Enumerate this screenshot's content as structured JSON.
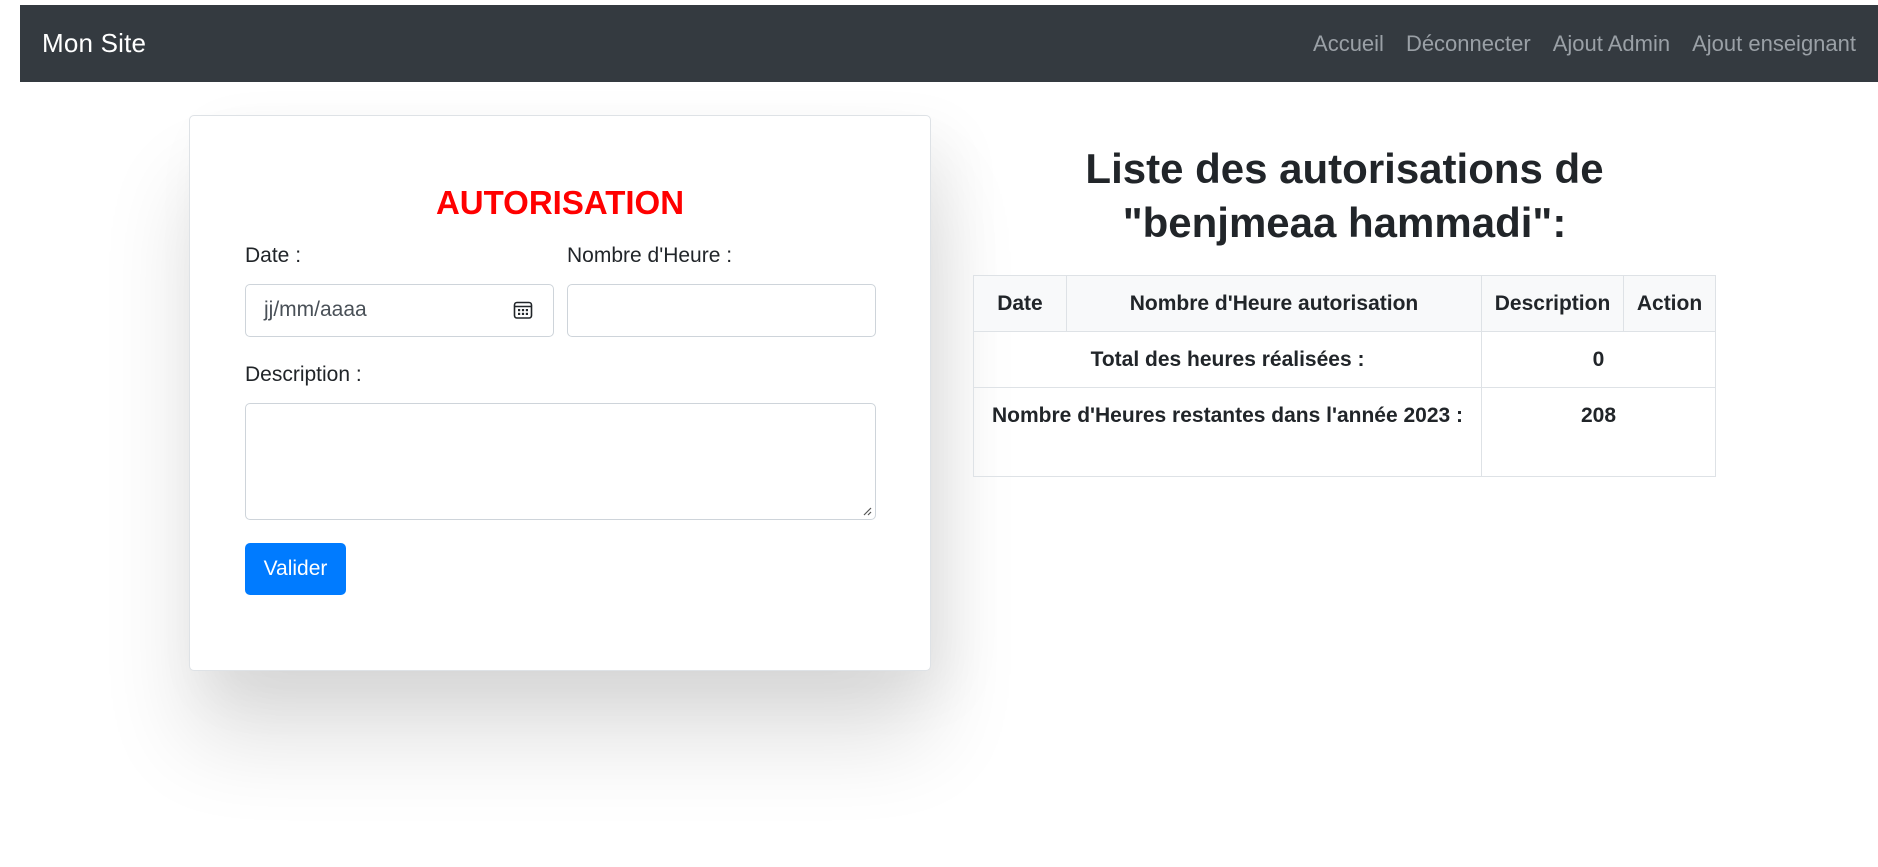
{
  "navbar": {
    "brand": "Mon Site",
    "links": [
      "Accueil",
      "Déconnecter",
      "Ajout Admin",
      "Ajout enseignant"
    ]
  },
  "form": {
    "title": "AUTORISATION",
    "date_label": "Date :",
    "date_placeholder": "jj/mm/aaaa",
    "hours_label": "Nombre d'Heure :",
    "hours_value": "",
    "description_label": "Description :",
    "description_value": "",
    "submit_label": "Valider"
  },
  "list": {
    "title": "Liste des autorisations de \"benjmeaa hammadi\":",
    "headers": [
      "Date",
      "Nombre d'Heure autorisation",
      "Description",
      "Action"
    ],
    "total_label": "Total des heures réalisées :",
    "total_value": "0",
    "remaining_label": "Nombre d'Heures restantes dans l'année 2023 :",
    "remaining_value": "208"
  },
  "colors": {
    "navbar_bg": "#343a40",
    "title_red": "#ff0000",
    "button_blue": "#007bff"
  }
}
